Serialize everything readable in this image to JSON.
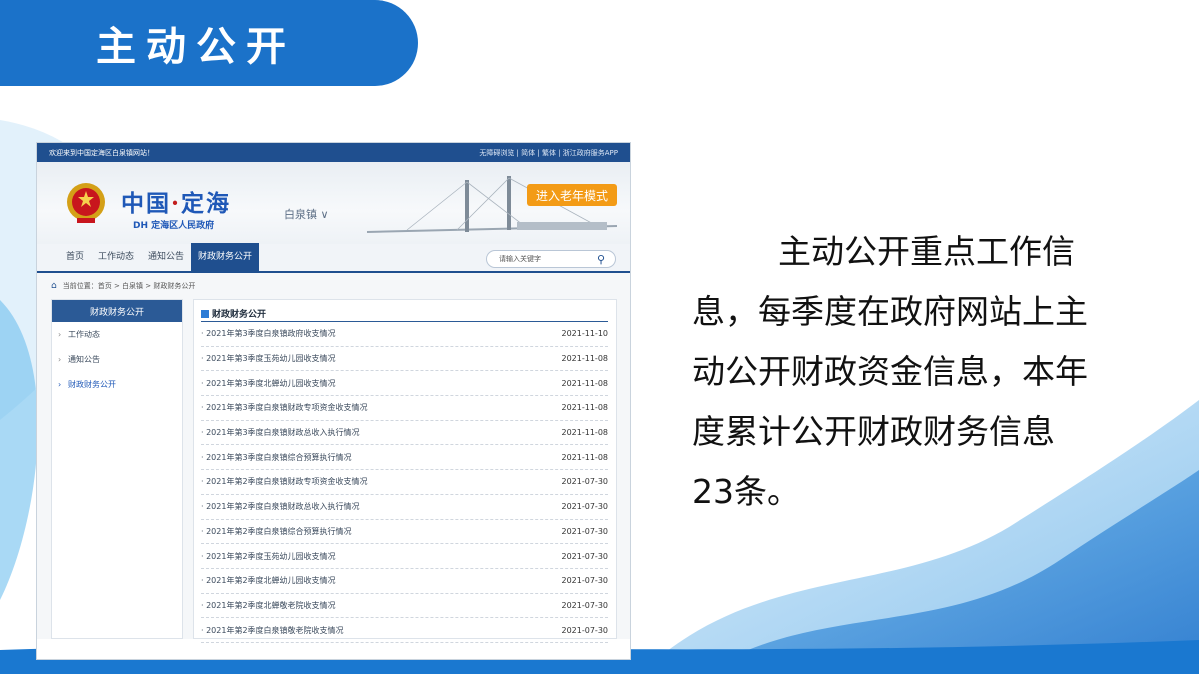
{
  "slide": {
    "title": "主动公开",
    "description": "主动公开重点工作信息，每季度在政府网站上主动公开财政资金信息，本年度累计公开财政财务信息23条。"
  },
  "site": {
    "welcome": "欢迎来到中国定海区白泉镇网站！",
    "top_links": "无障碍浏览 | 简体 | 繁体 | 浙江政府服务APP",
    "logo_main_1": "中国",
    "logo_dot": "·",
    "logo_main_2": "定海",
    "logo_sub": "DH 定海区人民政府",
    "town": "白泉镇 ∨",
    "elder_mode": "进入老年模式",
    "nav": [
      "首页",
      "工作动态",
      "通知公告",
      "财政财务公开"
    ],
    "search_placeholder": "请输入关键字",
    "search_icon": "search-icon",
    "breadcrumb": "当前位置：首页 > 白泉镇 > 财政财务公开",
    "sidebar_title": "财政财务公开",
    "sidebar_items": [
      "工作动态",
      "通知公告",
      "财政财务公开"
    ],
    "content_title": "财政财务公开",
    "rows": [
      {
        "title": "2021年第3季度白泉镇政府收支情况",
        "date": "2021-11-10"
      },
      {
        "title": "2021年第3季度玉苑幼儿园收支情况",
        "date": "2021-11-08"
      },
      {
        "title": "2021年第3季度北蝉幼儿园收支情况",
        "date": "2021-11-08"
      },
      {
        "title": "2021年第3季度白泉镇财政专项资金收支情况",
        "date": "2021-11-08"
      },
      {
        "title": "2021年第3季度白泉镇财政总收入执行情况",
        "date": "2021-11-08"
      },
      {
        "title": "2021年第3季度白泉镇综合预算执行情况",
        "date": "2021-11-08"
      },
      {
        "title": "2021年第2季度白泉镇财政专项资金收支情况",
        "date": "2021-07-30"
      },
      {
        "title": "2021年第2季度白泉镇财政总收入执行情况",
        "date": "2021-07-30"
      },
      {
        "title": "2021年第2季度白泉镇综合预算执行情况",
        "date": "2021-07-30"
      },
      {
        "title": "2021年第2季度玉苑幼儿园收支情况",
        "date": "2021-07-30"
      },
      {
        "title": "2021年第2季度北蝉幼儿园收支情况",
        "date": "2021-07-30"
      },
      {
        "title": "2021年第2季度北蝉敬老院收支情况",
        "date": "2021-07-30"
      },
      {
        "title": "2021年第2季度白泉镇敬老院收支情况",
        "date": "2021-07-30"
      }
    ]
  },
  "colors": {
    "accent": "#1b72c9",
    "site_blue": "#1f4f8f",
    "elder_orange": "#f39b16"
  }
}
